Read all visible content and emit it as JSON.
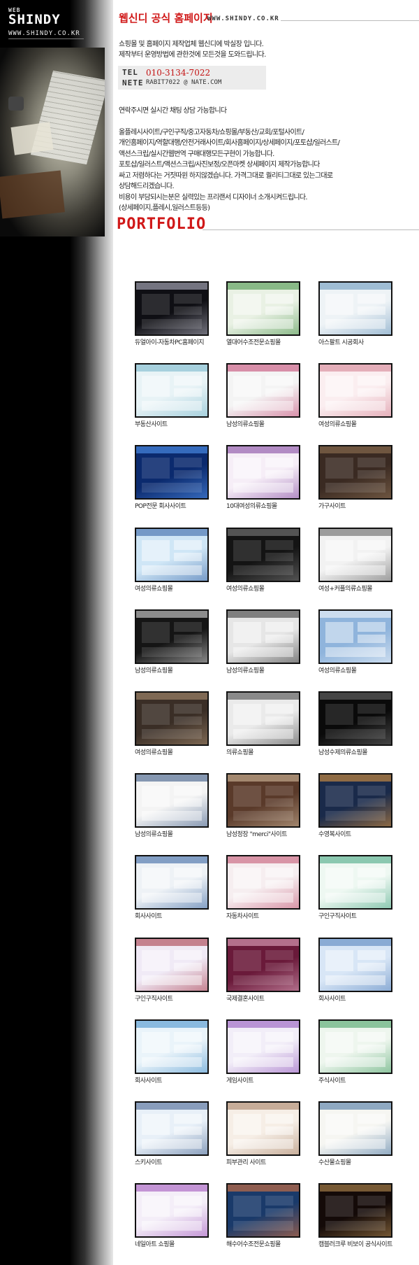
{
  "sidebar": {
    "brand_small": "WEB",
    "brand_name": "SHINDY",
    "brand_url": "WWW.SHINDY.CO.KR"
  },
  "header": {
    "title": "웹신디 공식 홈페이지",
    "url": "WWW.SHINDY.CO.KR"
  },
  "intro": {
    "line1": "쇼핑몰 및 홈페이지 제작업체 웹신디에 박실장 입니다.",
    "line2": "제작부터 운영방법에 관한것에 모든것을 도와드립니다."
  },
  "contact": {
    "tel_label": "TEL",
    "tel_value": "010-3134-7022",
    "nete_label": "NETE",
    "nete_value": "RABIT7022 @ NATE.COM"
  },
  "body_text": {
    "chat": "연락주시면 실시간 채팅 상담 가능합니다",
    "l1": "올플레시사이트/구인구직/중고자동차/쇼핑몰/부동산/교회/포털사이트/",
    "l2": "개인홈페이지/역할대행/안전거래사이트/회사홈페이지/상세페이지/포토샵/일러스트/",
    "l3": "액션스크립/실시간웹번역 구매대행모든구현이 가능합니다.",
    "l4": "포토샵/일러스트/액션스크립/사진보정/오픈마켓 상세페이지 제작가능합니다",
    "l5": "싸고 저렴하다는 거짓따윈 하지않겠습니다. 가격그대로 퀄리티그대로 있는그대로",
    "l6": "상담해드리겠습니다.",
    "l7": "비용이 부담되시는분은 실력있는 프리랜서 디자이너 소개시켜드립니다.",
    "l8": "(상세페이지,플레시,일러스트등등)"
  },
  "portfolio": {
    "title": "PORTFOLIO",
    "items": [
      {
        "caption": "듀얼아이-자동차PC홈페이지",
        "bg": "#0f0f14",
        "accent": "#c8c8d8",
        "dark": true
      },
      {
        "caption": "열대어수조전문쇼핑몰",
        "bg": "#e9f1e4",
        "accent": "#3a8a3a",
        "dark": false
      },
      {
        "caption": "아스팔트 시공회사",
        "bg": "#eef3f6",
        "accent": "#5e8fb8",
        "dark": false
      },
      {
        "caption": "부동산사이트",
        "bg": "#e8f3f6",
        "accent": "#6fb3c8",
        "dark": false
      },
      {
        "caption": "남성의류쇼핑몰",
        "bg": "#f4f4f4",
        "accent": "#c03a6a",
        "dark": false
      },
      {
        "caption": "여성의류쇼핑몰",
        "bg": "#fbeef0",
        "accent": "#d27a8c",
        "dark": false
      },
      {
        "caption": "POP전문 회사사이트",
        "bg": "#0b2a6e",
        "accent": "#5aa0ff",
        "dark": true
      },
      {
        "caption": "10대여성의류쇼핑몰",
        "bg": "#f6eef7",
        "accent": "#7a3a9a",
        "dark": false
      },
      {
        "caption": "가구사이트",
        "bg": "#3a2a22",
        "accent": "#9a7a5a",
        "dark": true
      },
      {
        "caption": "여성의류쇼핑몰",
        "bg": "#cfe6f6",
        "accent": "#2a5aa0",
        "dark": false
      },
      {
        "caption": "여성의류쇼핑몰",
        "bg": "#141414",
        "accent": "#888888",
        "dark": true
      },
      {
        "caption": "여성+커플의류쇼핑몰",
        "bg": "#f2f2f2",
        "accent": "#555555",
        "dark": false
      },
      {
        "caption": "남성의류쇼핑몰",
        "bg": "#151515",
        "accent": "#eeeeee",
        "dark": true
      },
      {
        "caption": "남성의류쇼핑몰",
        "bg": "#e6e6e6",
        "accent": "#2a2a2a",
        "dark": false
      },
      {
        "caption": "여성의류쇼핑몰",
        "bg": "#8fb4dc",
        "accent": "#ffffff",
        "dark": false
      },
      {
        "caption": "여성의류쇼핑몰",
        "bg": "#3a2e26",
        "accent": "#b89a7a",
        "dark": true
      },
      {
        "caption": "의류쇼핑몰",
        "bg": "#eaeaea",
        "accent": "#3a3a3a",
        "dark": false
      },
      {
        "caption": "남성수제의류쇼핑몰",
        "bg": "#0a0a0a",
        "accent": "#777777",
        "dark": true
      },
      {
        "caption": "남성의류쇼핑몰",
        "bg": "#f4f4f4",
        "accent": "#2a4a7a",
        "dark": false
      },
      {
        "caption": "남성정장 \"merci\"사이트",
        "bg": "#5a3a2a",
        "accent": "#e0c8a8",
        "dark": true
      },
      {
        "caption": "수영복사이트",
        "bg": "#1a2a4a",
        "accent": "#f0a040",
        "dark": true
      },
      {
        "caption": "회사사이트",
        "bg": "#eef2f6",
        "accent": "#2a5a9a",
        "dark": false
      },
      {
        "caption": "자동차사이트",
        "bg": "#f6eef0",
        "accent": "#c04a6a",
        "dark": false
      },
      {
        "caption": "구인구직사이트",
        "bg": "#eef8f2",
        "accent": "#3aa07a",
        "dark": false
      },
      {
        "caption": "구인구직사이트",
        "bg": "#f0eaf6",
        "accent": "#a02a3a",
        "dark": false
      },
      {
        "caption": "국제결혼사이트",
        "bg": "#6a1a3a",
        "accent": "#f0b8d0",
        "dark": true
      },
      {
        "caption": "회사사이트",
        "bg": "#d8e6f6",
        "accent": "#4a7ab8",
        "dark": false
      },
      {
        "caption": "회사사이트",
        "bg": "#eaf4fa",
        "accent": "#3a8ac8",
        "dark": false
      },
      {
        "caption": "게임사이트",
        "bg": "#f2eef8",
        "accent": "#8a4ab8",
        "dark": false
      },
      {
        "caption": "주식사이트",
        "bg": "#eef6ee",
        "accent": "#3a9a5a",
        "dark": false
      },
      {
        "caption": "스키사이트",
        "bg": "#e8f0f8",
        "accent": "#3a5a8a",
        "dark": false
      },
      {
        "caption": "피부관리 사이트",
        "bg": "#f6eee6",
        "accent": "#a0785a",
        "dark": false
      },
      {
        "caption": "수산물쇼핑몰",
        "bg": "#f6f6f2",
        "accent": "#3a6a9a",
        "dark": false
      },
      {
        "caption": "네일아트 쇼핑몰",
        "bg": "#f4eef8",
        "accent": "#9a4ab8",
        "dark": false
      },
      {
        "caption": "해수어수조전문쇼핑몰",
        "bg": "#1a3a6a",
        "accent": "#f07a3a",
        "dark": true
      },
      {
        "caption": "캠블러크루 비보이 공식사이트",
        "bg": "#140a08",
        "accent": "#c89a5a",
        "dark": true
      }
    ]
  }
}
